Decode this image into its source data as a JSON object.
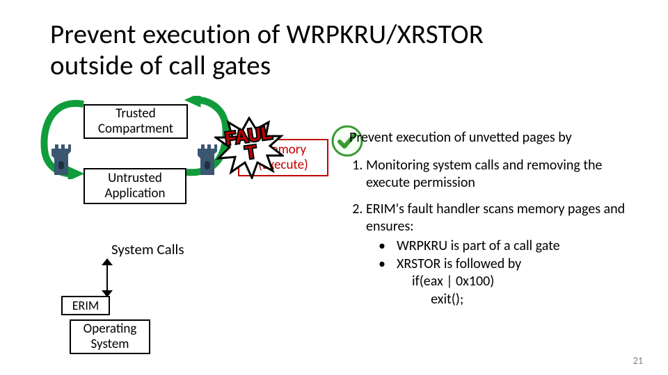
{
  "title": "Prevent execution of WRPKRU/XRSTOR\noutside of call gates",
  "page_number": "21",
  "diagram": {
    "trusted_label": "Trusted\nCompartment",
    "untrusted_label": "Untrusted\nApplication",
    "erim_label": "ERIM",
    "os_label": "Operating\nSystem",
    "memory_label": "Memory\n(Execute)",
    "syscalls_label": "System Calls",
    "fault_label": "FAULT"
  },
  "icons": {
    "tower": "tower-icon",
    "checkmark": "checkmark-icon",
    "starburst": "starburst-icon"
  },
  "right": {
    "intro": "Prevent execution of unvetted pages by",
    "item1": "Monitoring system calls and removing the execute permission",
    "item2_lead": "ERIM's fault handler scans memory pages and ensures:",
    "item2_b1": "WRPKRU is part of a call gate",
    "item2_b2": "XRSTOR is followed by",
    "item2_code": "if(eax | 0x100)\n      exit();"
  },
  "colors": {
    "accent_red": "#c00000",
    "accent_green": "#119c3b",
    "check_green": "#3a9a34"
  }
}
